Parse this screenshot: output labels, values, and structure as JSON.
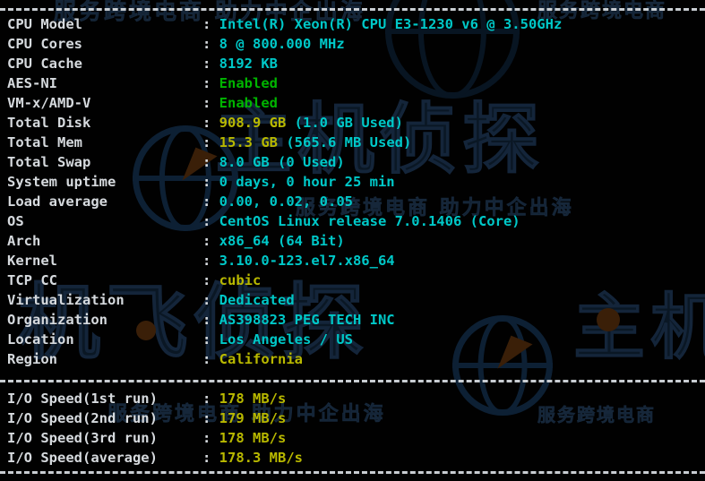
{
  "terminal": {
    "background_color": "#010101",
    "label_color": "#d6dade",
    "value_color_cyan": "#00c8c8",
    "value_color_yellow": "#b8b800",
    "value_color_green": "#00b400",
    "separator_color": "#c8cdd2"
  },
  "watermark": {
    "tagline": "服务跨境电商 助力中企出海",
    "brand_left": "机飞侦探",
    "brand_right": "主机",
    "brand_center": "主机侦探",
    "subtitle": "服务跨境电商"
  },
  "system_info": [
    {
      "label": "CPU Model",
      "value": "Intel(R) Xeon(R) CPU E3-1230 v6 @ 3.50GHz",
      "color": "cyan"
    },
    {
      "label": "CPU Cores",
      "value": "8 @ 800.000 MHz",
      "color": "cyan"
    },
    {
      "label": "CPU Cache",
      "value": "8192 KB",
      "color": "cyan"
    },
    {
      "label": "AES-NI",
      "value": "Enabled",
      "color": "green"
    },
    {
      "label": "VM-x/AMD-V",
      "value": "Enabled",
      "color": "green"
    },
    {
      "label": "Total Disk",
      "value_highlight": "908.9 GB",
      "value": " (1.0 GB Used)",
      "color": "mixed"
    },
    {
      "label": "Total Mem",
      "value_highlight": "15.3 GB",
      "value": " (565.6 MB Used)",
      "color": "mixed"
    },
    {
      "label": "Total Swap",
      "value": "8.0 GB (0 Used)",
      "color": "cyan"
    },
    {
      "label": "System uptime",
      "value": "0 days, 0 hour 25 min",
      "color": "cyan"
    },
    {
      "label": "Load average",
      "value": "0.00, 0.02, 0.05",
      "color": "cyan"
    },
    {
      "label": "OS",
      "value": "CentOS Linux release 7.0.1406 (Core)",
      "color": "cyan"
    },
    {
      "label": "Arch",
      "value": "x86_64 (64 Bit)",
      "color": "cyan"
    },
    {
      "label": "Kernel",
      "value": "3.10.0-123.el7.x86_64",
      "color": "cyan"
    },
    {
      "label": "TCP CC",
      "value": "cubic",
      "color": "yellow"
    },
    {
      "label": "Virtualization",
      "value": "Dedicated",
      "color": "cyan"
    },
    {
      "label": "Organization",
      "value": "AS398823 PEG TECH INC",
      "color": "cyan"
    },
    {
      "label": "Location",
      "value": "Los Angeles / US",
      "color": "cyan"
    },
    {
      "label": "Region",
      "value": "California",
      "color": "yellow"
    }
  ],
  "io_speed": [
    {
      "label": "I/O Speed(1st run)",
      "value": "178 MB/s",
      "color": "yellow"
    },
    {
      "label": "I/O Speed(2nd run)",
      "value": "179 MB/s",
      "color": "yellow"
    },
    {
      "label": "I/O Speed(3rd run)",
      "value": "178 MB/s",
      "color": "yellow"
    },
    {
      "label": "I/O Speed(average)",
      "value": "178.3 MB/s",
      "color": "yellow"
    }
  ],
  "separators": {
    "count": 3,
    "style": "dashed"
  }
}
